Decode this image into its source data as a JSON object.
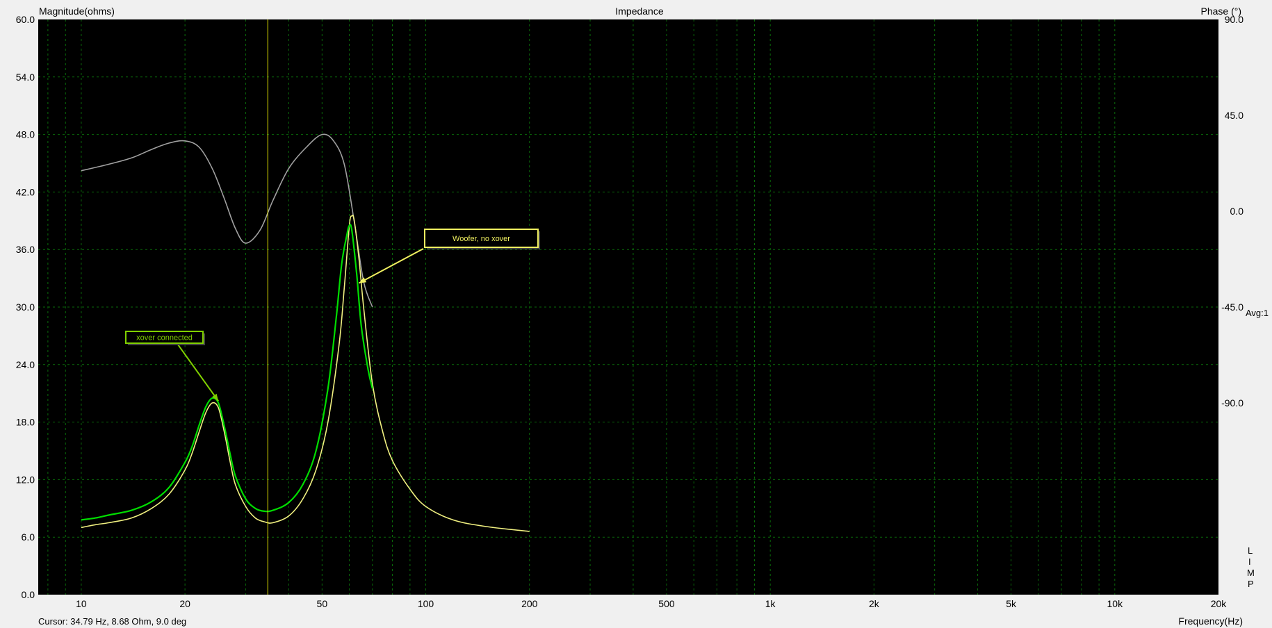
{
  "chart_data": {
    "type": "line",
    "title": "Impedance",
    "ylabel_left": "Magnitude(ohms)",
    "ylabel_right": "Phase (°)",
    "xlabel": "Frequency(Hz)",
    "xscale": "log",
    "xlim": [
      7.5,
      20000
    ],
    "ylim_left": [
      0,
      60
    ],
    "ylim_right": [
      -180,
      90
    ],
    "grid": true,
    "background": "#000000",
    "x_ticks": [
      {
        "value": 10,
        "label": "10"
      },
      {
        "value": 20,
        "label": "20"
      },
      {
        "value": 50,
        "label": "50"
      },
      {
        "value": 100,
        "label": "100"
      },
      {
        "value": 200,
        "label": "200"
      },
      {
        "value": 500,
        "label": "500"
      },
      {
        "value": 1000,
        "label": "1k"
      },
      {
        "value": 2000,
        "label": "2k"
      },
      {
        "value": 5000,
        "label": "5k"
      },
      {
        "value": 10000,
        "label": "10k"
      },
      {
        "value": 20000,
        "label": "20k"
      }
    ],
    "y_ticks_left": [
      "0.0",
      "6.0",
      "12.0",
      "18.0",
      "24.0",
      "30.0",
      "36.0",
      "42.0",
      "48.0",
      "54.0",
      "60.0"
    ],
    "y_ticks_right": [
      {
        "value": 90,
        "label": "90.0"
      },
      {
        "value": 45,
        "label": "45.0"
      },
      {
        "value": 0,
        "label": "0.0"
      },
      {
        "value": -45,
        "label": "-45.0"
      },
      {
        "value": -90,
        "label": "-90.0"
      }
    ],
    "series": [
      {
        "color": "#a0a0a0",
        "axis": "right",
        "x": [
          10,
          12,
          14,
          16,
          18,
          20,
          22,
          24,
          26,
          28,
          30,
          33,
          36,
          40,
          45,
          50,
          54,
          58,
          62,
          66,
          70
        ],
        "y": [
          19,
          22,
          25,
          29,
          32,
          33,
          30,
          20,
          6,
          -8,
          -15,
          -9,
          5,
          20,
          30,
          36,
          33,
          22,
          -5,
          -33,
          -45
        ]
      },
      {
        "color": "#f0f080",
        "axis": "left",
        "x": [
          10,
          11,
          12,
          14,
          16,
          18,
          20,
          21,
          22,
          23,
          24,
          25,
          26,
          27,
          28,
          30,
          32,
          34,
          36,
          40,
          44,
          48,
          52,
          56,
          58,
          60,
          61,
          62,
          64,
          66,
          70,
          75,
          80,
          90,
          100,
          120,
          150,
          200
        ],
        "y": [
          7.0,
          7.3,
          7.5,
          8.0,
          9.0,
          10.5,
          13.0,
          14.8,
          17.0,
          19.0,
          20.0,
          19.5,
          17.0,
          14.0,
          11.5,
          9.2,
          8.0,
          7.6,
          7.5,
          8.2,
          10.0,
          13.0,
          18.0,
          26.0,
          32.0,
          38.5,
          39.5,
          39.0,
          35.0,
          30.0,
          22.0,
          17.0,
          14.0,
          11.0,
          9.2,
          7.8,
          7.1,
          6.6
        ]
      },
      {
        "color": "#00dd00",
        "axis": "left",
        "x": [
          10,
          11,
          12,
          14,
          16,
          18,
          20,
          21,
          22,
          23,
          24,
          25,
          26,
          27,
          28,
          30,
          32,
          34,
          36,
          40,
          44,
          48,
          52,
          55,
          57,
          59,
          60,
          61,
          63,
          65,
          68,
          70
        ],
        "y": [
          7.8,
          8.0,
          8.3,
          8.8,
          9.7,
          11.2,
          13.8,
          15.5,
          17.7,
          19.6,
          20.5,
          20.0,
          17.6,
          14.8,
          12.4,
          10.0,
          9.0,
          8.7,
          8.8,
          9.6,
          11.5,
          15.0,
          21.5,
          29.0,
          34.5,
          37.5,
          38.5,
          38.0,
          33.5,
          28.0,
          23.5,
          21.5
        ]
      }
    ],
    "annotations": [
      {
        "text": "Woofer, no xover",
        "color": "#f0f060",
        "target_x": 64,
        "target_y": 32.5
      },
      {
        "text": "xover connected",
        "color": "#80d000",
        "target_x": 25,
        "target_y": 20.2
      }
    ],
    "cursor": {
      "x": 34.79,
      "color": "#e0e000"
    }
  },
  "status": {
    "cursor_readout": "Cursor: 34.79 Hz, 8.68 Ohm, 9.0 deg",
    "avg": "Avg:1",
    "mode_letters": [
      "L",
      "I",
      "M",
      "P"
    ]
  }
}
